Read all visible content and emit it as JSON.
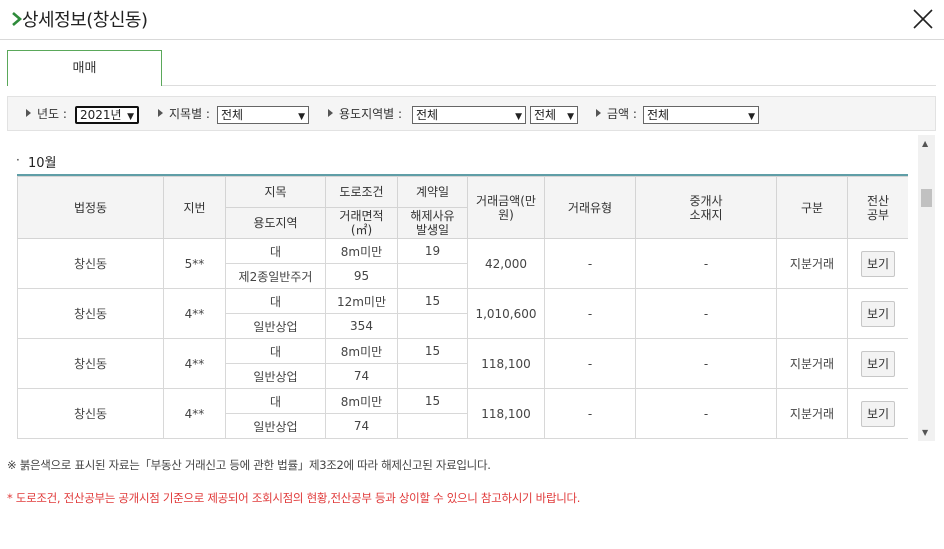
{
  "window": {
    "title": "상세정보(창신동)",
    "colors": {
      "accent_green": "#2e8b3a",
      "header_line": "#5f9ea7",
      "warning_red": "#e03a3a"
    }
  },
  "tabs": [
    {
      "label": "매매",
      "active": true
    }
  ],
  "filters": {
    "year": {
      "label": "년도 :",
      "value": "2021년"
    },
    "jimok": {
      "label": "지목별 :",
      "value": "전체"
    },
    "zone": {
      "label": "용도지역별 :",
      "value": "전체",
      "sub_value": "전체"
    },
    "amount": {
      "label": "금액 :",
      "value": "전체"
    }
  },
  "month": {
    "bullet": "·",
    "label": "10월"
  },
  "table": {
    "headers": {
      "beopjeongdong": "법정동",
      "jibeon": "지번",
      "jimok": "지목",
      "yongdo": "용도지역",
      "road": "도로조건",
      "area": "거래면적\n(㎡)",
      "contract": "계약일",
      "cancel": "해제사유\n발생일",
      "amount": "거래금액(만\n원)",
      "type": "거래유형",
      "agent": "중개사\n소재지",
      "gubun": "구분",
      "doc": "전산\n공부"
    },
    "rows": [
      {
        "dong": "창신동",
        "jibeon": "5**",
        "jimok": "대",
        "yongdo": "제2종일반주거",
        "road": "8m미만",
        "area": "95",
        "contract": "19",
        "cancel": "",
        "amount": "42,000",
        "type": "-",
        "agent": "-",
        "gubun": "지분거래",
        "button": "보기"
      },
      {
        "dong": "창신동",
        "jibeon": "4**",
        "jimok": "대",
        "yongdo": "일반상업",
        "road": "12m미만",
        "area": "354",
        "contract": "15",
        "cancel": "",
        "amount": "1,010,600",
        "type": "-",
        "agent": "-",
        "gubun": "",
        "button": "보기"
      },
      {
        "dong": "창신동",
        "jibeon": "4**",
        "jimok": "대",
        "yongdo": "일반상업",
        "road": "8m미만",
        "area": "74",
        "contract": "15",
        "cancel": "",
        "amount": "118,100",
        "type": "-",
        "agent": "-",
        "gubun": "지분거래",
        "button": "보기"
      },
      {
        "dong": "창신동",
        "jibeon": "4**",
        "jimok": "대",
        "yongdo": "일반상업",
        "road": "8m미만",
        "area": "74",
        "contract": "15",
        "cancel": "",
        "amount": "118,100",
        "type": "-",
        "agent": "-",
        "gubun": "지분거래",
        "button": "보기"
      }
    ]
  },
  "notes": {
    "note1": "※ 붉은색으로 표시된 자료는「부동산 거래신고 등에 관한 법률」제3조2에 따라 해제신고된 자료입니다.",
    "note2": "* 도로조건, 전산공부는 공개시점 기준으로 제공되어 조회시점의 현황,전산공부 등과 상이할 수 있으니 참고하시기 바랍니다."
  }
}
